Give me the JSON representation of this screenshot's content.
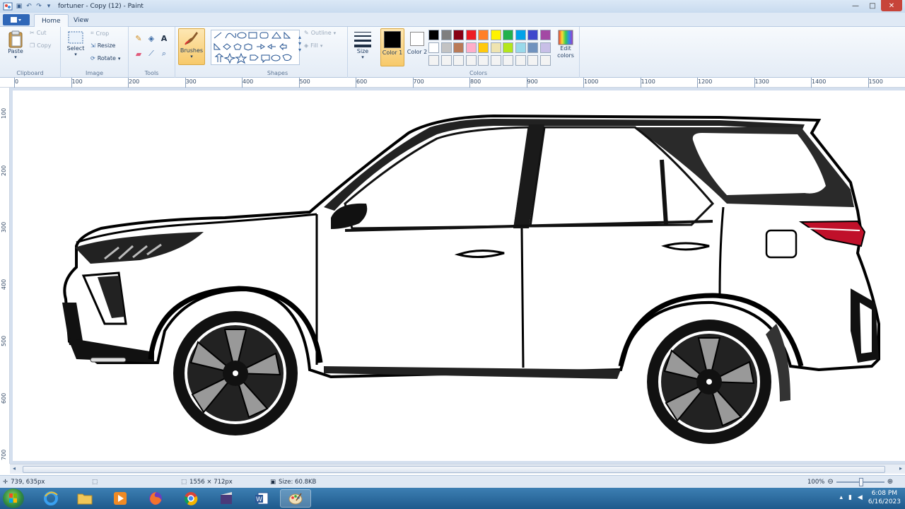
{
  "window": {
    "title": "fortuner - Copy (12) - Paint",
    "minimize": "—",
    "maximize": "□",
    "close": "✕"
  },
  "tabs": [
    "Home",
    "View"
  ],
  "ribbon": {
    "clipboard": {
      "label": "Clipboard",
      "paste": "Paste",
      "cut": "Cut",
      "copy": "Copy"
    },
    "image": {
      "label": "Image",
      "select": "Select",
      "crop": "Crop",
      "resize": "Resize",
      "rotate": "Rotate"
    },
    "tools": {
      "label": "Tools"
    },
    "brushes": {
      "label": "Brushes"
    },
    "shapes": {
      "label": "Shapes",
      "outline": "Outline",
      "fill": "Fill"
    },
    "size": {
      "label": "Size"
    },
    "colors": {
      "label": "Colors",
      "color1": "Color 1",
      "color2": "Color 2",
      "edit_colors": "Edit colors",
      "color1_value": "#000000",
      "color2_value": "#ffffff",
      "palette_row1": [
        "#000000",
        "#7f7f7f",
        "#880015",
        "#ed1c24",
        "#ff7f27",
        "#fff200",
        "#22b14c",
        "#00a2e8",
        "#3f48cc",
        "#a349a4"
      ],
      "palette_row2": [
        "#ffffff",
        "#c3c3c3",
        "#b97a57",
        "#ffaec9",
        "#ffc90e",
        "#efe4b0",
        "#b5e61d",
        "#99d9ea",
        "#7092be",
        "#c8bfe7"
      ]
    }
  },
  "ruler": {
    "top": [
      "0",
      "100",
      "200",
      "300",
      "400",
      "500",
      "600",
      "700",
      "800",
      "900",
      "1000",
      "1100",
      "1200",
      "1300",
      "1400",
      "1500"
    ],
    "left": [
      "100",
      "200",
      "300",
      "400",
      "500",
      "600",
      "700"
    ]
  },
  "status": {
    "cursor": "739, 635px",
    "dimensions": "1556 × 712px",
    "size": "Size: 60.8KB",
    "zoom": "100%"
  },
  "taskbar": {
    "time": "6:08 PM",
    "date": "6/16/2023"
  }
}
